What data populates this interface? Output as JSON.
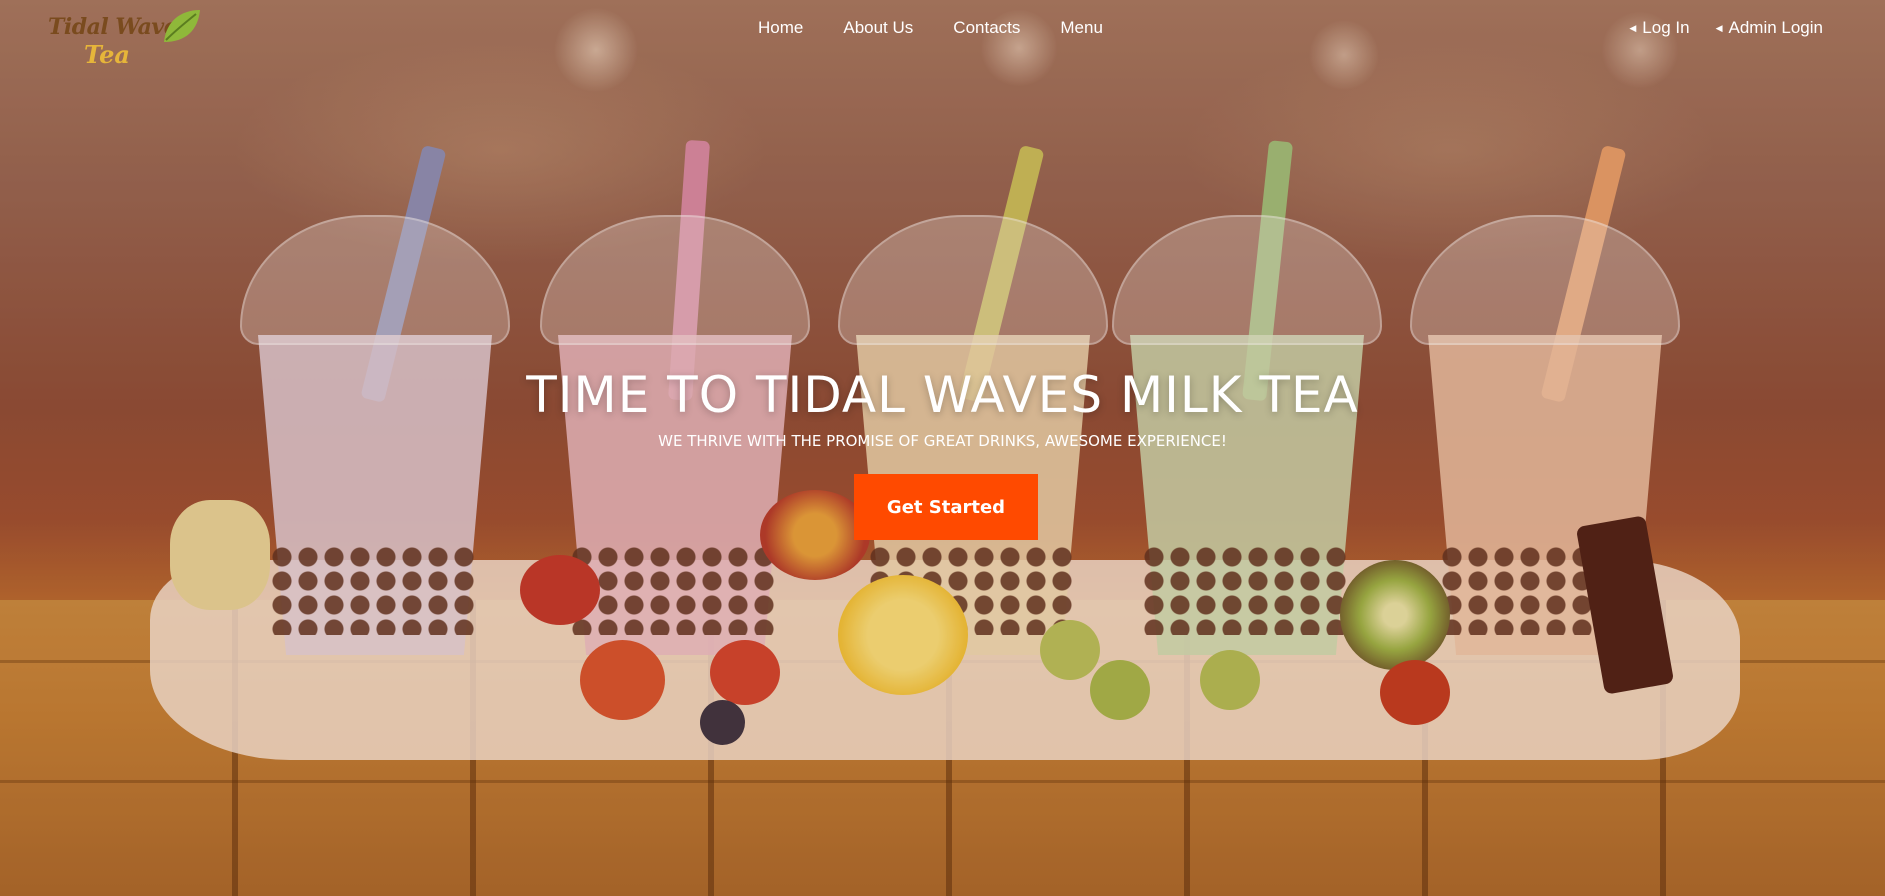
{
  "brand": {
    "logo_line1": "Tidal Waves",
    "logo_line2": "Tea"
  },
  "nav": {
    "links": [
      "Home",
      "About Us",
      "Contacts",
      "Menu"
    ],
    "login": "Log In",
    "admin_login": "Admin Login"
  },
  "hero": {
    "title": "TIME TO TIDAL WAVES MILK TEA",
    "subtitle": "WE THRIVE WITH THE PROMISE OF GREAT DRINKS, AWESOME EXPERIENCE!",
    "cta_label": "Get Started"
  },
  "colors": {
    "accent": "#ff4a00",
    "nav_text": "#ffffff",
    "logo_brown": "#7a4b1e",
    "logo_gold": "#e6b53a"
  }
}
